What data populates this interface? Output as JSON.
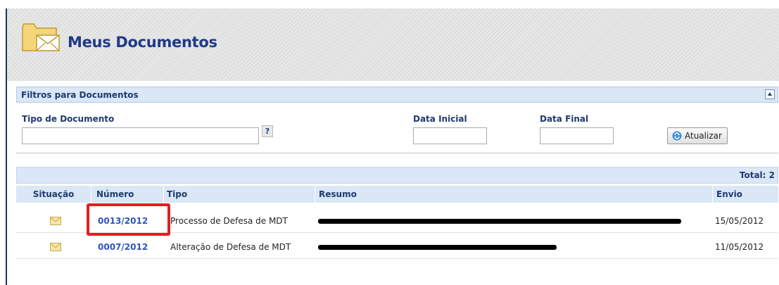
{
  "header": {
    "title": "Meus Documentos",
    "icon": "folder-mail-icon"
  },
  "filters": {
    "section_title": "Filtros para Documentos",
    "tipo_label": "Tipo de Documento",
    "tipo_value": "",
    "help_label": "?",
    "data_inicial_label": "Data Inicial",
    "data_inicial_value": "",
    "data_final_label": "Data Final",
    "data_final_value": "",
    "atualizar_label": "Atualizar"
  },
  "table": {
    "total": "Total: 2",
    "columns": {
      "situacao": "Situação",
      "numero": "Número",
      "tipo": "Tipo",
      "resumo": "Resumo",
      "envio": "Envio"
    },
    "rows": [
      {
        "numero": "0013/2012",
        "tipo": "Processo de Defesa de MDT",
        "envio": "15/05/2012",
        "situacao_icon": "envelope-icon"
      },
      {
        "numero": "0007/2012",
        "tipo": "Alteração de Defesa de MDT",
        "envio": "11/05/2012",
        "situacao_icon": "envelope-icon"
      }
    ]
  },
  "colors": {
    "accent": "#1f3a87",
    "panel": "#d9e7f6",
    "highlight": "#e41e1e"
  }
}
